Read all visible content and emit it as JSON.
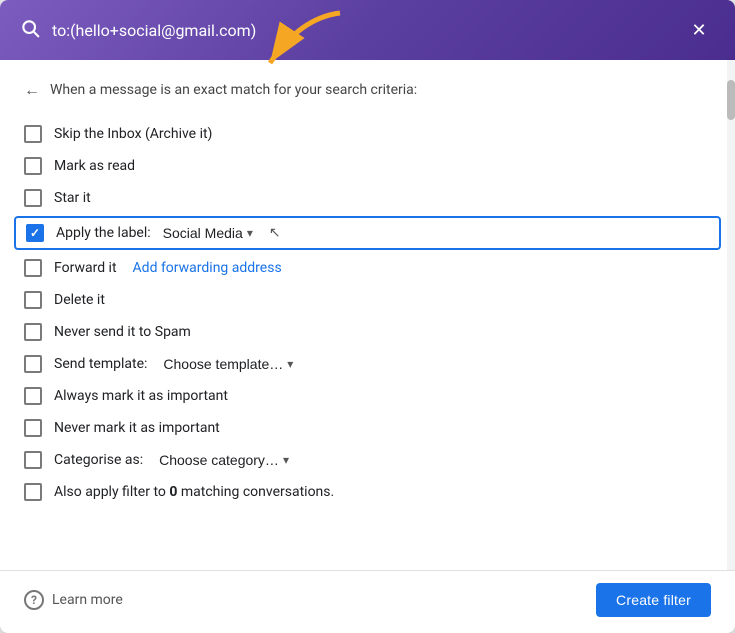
{
  "header": {
    "query": "to:(hello+social@gmail.com)",
    "search_icon": "🔍",
    "close_icon": "✕"
  },
  "subtitle": {
    "back_icon": "←",
    "text": "When a message is an exact match for your search criteria:"
  },
  "filter_options": [
    {
      "id": "skip-inbox",
      "label": "Skip the Inbox (Archive it)",
      "checked": false
    },
    {
      "id": "mark-read",
      "label": "Mark as read",
      "checked": false
    },
    {
      "id": "star-it",
      "label": "Star it",
      "checked": false
    },
    {
      "id": "apply-label",
      "label": "Apply the label:",
      "checked": true,
      "dropdown": "Social Media",
      "highlighted": true
    },
    {
      "id": "forward-it",
      "label": "Forward it",
      "checked": false,
      "link": "Add forwarding address"
    },
    {
      "id": "delete-it",
      "label": "Delete it",
      "checked": false
    },
    {
      "id": "never-spam",
      "label": "Never send it to Spam",
      "checked": false
    },
    {
      "id": "send-template",
      "label": "Send template:",
      "checked": false,
      "dropdown": "Choose template…"
    },
    {
      "id": "always-important",
      "label": "Always mark it as important",
      "checked": false
    },
    {
      "id": "never-important",
      "label": "Never mark it as important",
      "checked": false
    },
    {
      "id": "categorise",
      "label": "Categorise as:",
      "checked": false,
      "dropdown": "Choose category…"
    },
    {
      "id": "also-apply",
      "label": "Also apply filter to",
      "checked": false,
      "bold_part": "0",
      "suffix": "matching conversations."
    }
  ],
  "footer": {
    "help_icon": "?",
    "learn_more": "Learn more",
    "create_button": "Create filter"
  }
}
